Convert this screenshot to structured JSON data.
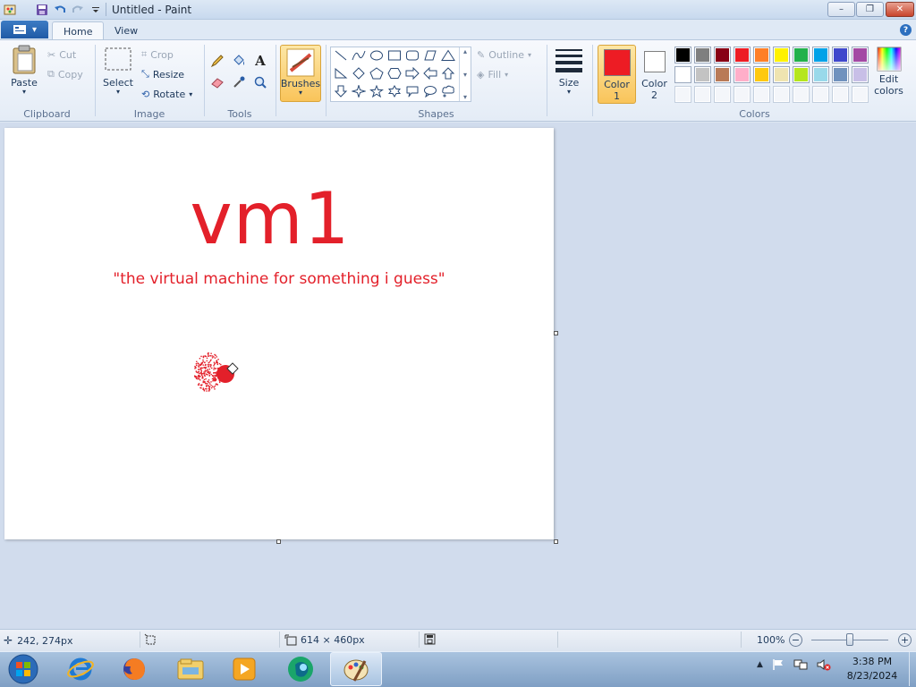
{
  "window": {
    "title": "Untitled - Paint",
    "minimize_glyph": "–",
    "maximize_glyph": "❐",
    "close_glyph": "✕"
  },
  "quick_access": {
    "items": [
      "paint-app-icon",
      "save-icon",
      "undo-icon",
      "redo-icon",
      "customize-dropdown-icon"
    ]
  },
  "tabs": {
    "home": "Home",
    "view": "View"
  },
  "ribbon": {
    "clipboard": {
      "label": "Clipboard",
      "paste": "Paste",
      "cut": "Cut",
      "copy": "Copy"
    },
    "image": {
      "label": "Image",
      "select": "Select",
      "crop": "Crop",
      "resize": "Resize",
      "rotate": "Rotate"
    },
    "tools": {
      "label": "Tools"
    },
    "brushes": {
      "label": "Brushes"
    },
    "shapes": {
      "label": "Shapes",
      "outline": "Outline",
      "fill": "Fill"
    },
    "size": {
      "label": "Size"
    },
    "colors": {
      "label": "Colors",
      "color1_line1": "Color",
      "color1_line2": "1",
      "color2_line1": "Color",
      "color2_line2": "2",
      "edit_line1": "Edit",
      "edit_line2": "colors",
      "color1_value": "#ed1c24",
      "color2_value": "#ffffff",
      "palette_row1": [
        "#000000",
        "#7f7f7f",
        "#880015",
        "#ed1c24",
        "#ff7f27",
        "#fff200",
        "#22b14c",
        "#00a2e8",
        "#3f48cc",
        "#a349a4"
      ],
      "palette_row2": [
        "#ffffff",
        "#c3c3c3",
        "#b97a57",
        "#ffaec9",
        "#ffc90e",
        "#efe4b0",
        "#b5e61d",
        "#99d9ea",
        "#7092be",
        "#c8bfe7"
      ]
    }
  },
  "canvas": {
    "heading": "vm1",
    "subtitle": "\"the virtual machine for something i guess\"",
    "ink_color": "#e3202a"
  },
  "status": {
    "cursor_position": "242, 274px",
    "canvas_size": "614 × 460px",
    "zoom": "100%"
  },
  "taskbar": {
    "items": [
      "start-orb-icon",
      "internet-explorer-icon",
      "firefox-icon",
      "file-explorer-icon",
      "media-player-icon",
      "app-icon",
      "paint-taskbar-icon"
    ],
    "time": "3:38 PM",
    "date": "8/23/2024"
  }
}
